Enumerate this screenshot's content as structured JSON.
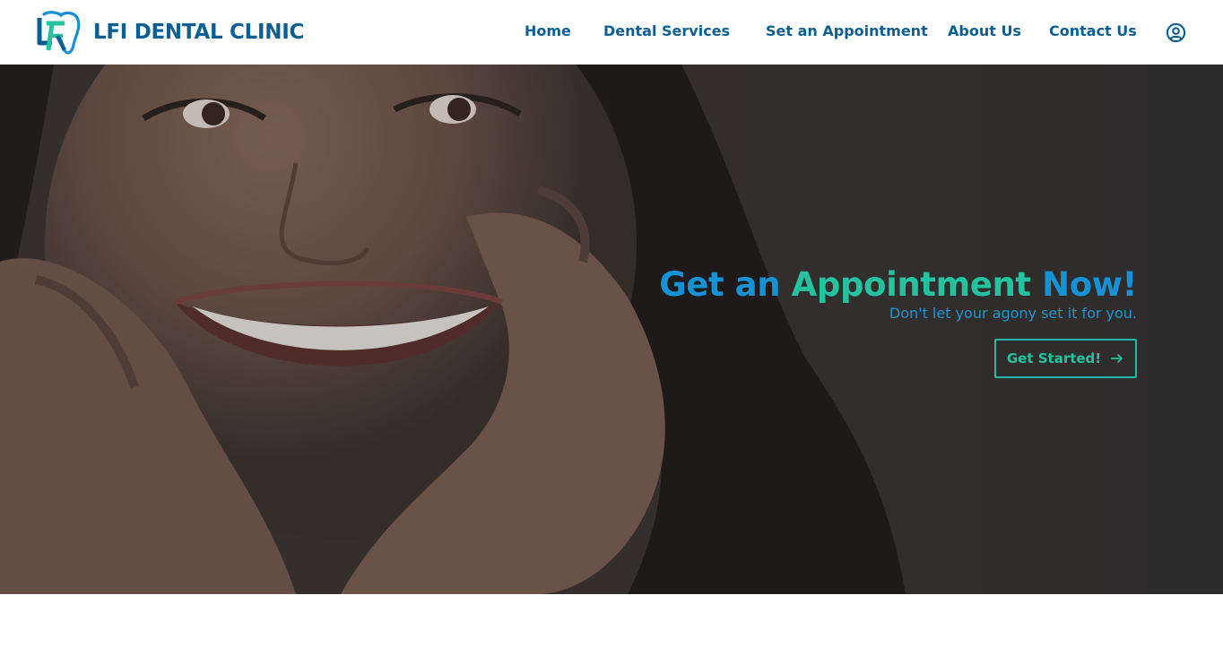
{
  "brand": {
    "name": "LFI DENTAL CLINIC",
    "logo_icon": "tooth-lf-logo-icon"
  },
  "nav": {
    "items": [
      {
        "label": "Home"
      },
      {
        "label": "Dental Services"
      },
      {
        "label": "Set an Appointment"
      },
      {
        "label": "About Us"
      },
      {
        "label": "Contact Us"
      }
    ],
    "account_icon": "user-circle-icon"
  },
  "hero": {
    "title_parts": [
      "Get an",
      "Appointment",
      "Now!"
    ],
    "subtitle": "Don't let your agony set it for you.",
    "cta_label": "Get Started!",
    "cta_icon": "arrow-right-icon",
    "image": "smiling woman with hands on cheeks"
  },
  "colors": {
    "brand_blue": "#0b5e91",
    "accent_blue": "#1592d6",
    "accent_teal": "#25c2a0"
  }
}
